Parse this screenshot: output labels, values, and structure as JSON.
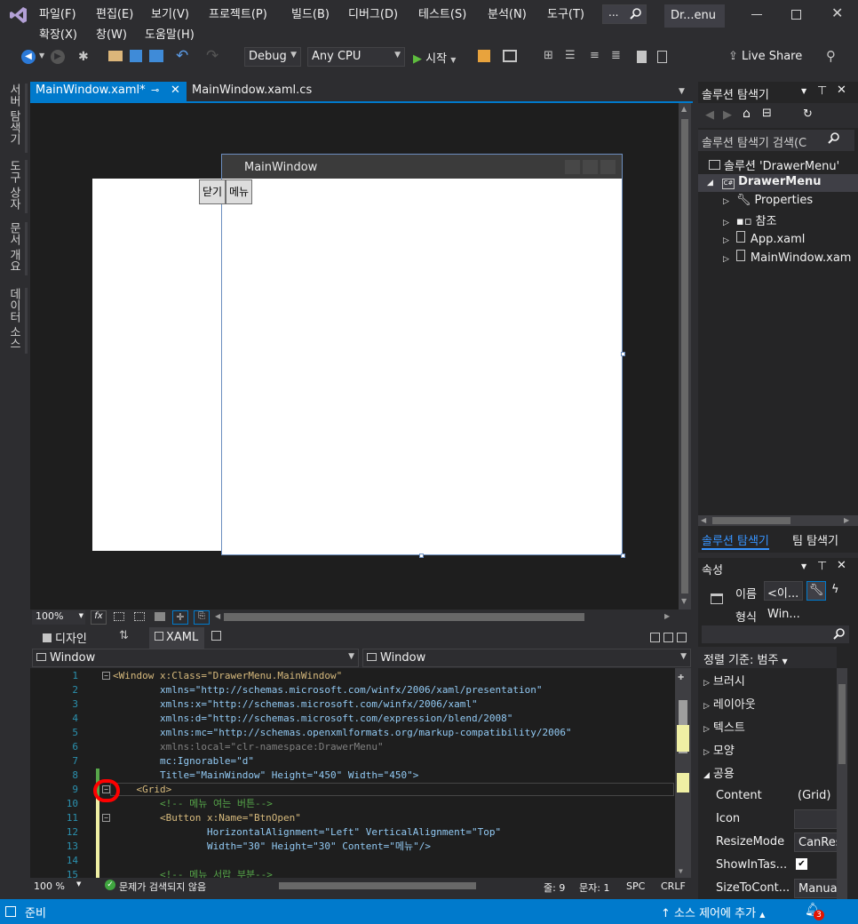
{
  "menus": [
    "파일(F)",
    "편집(E)",
    "보기(V)",
    "프로젝트(P)",
    "빌드(B)",
    "디버그(D)",
    "테스트(S)",
    "분석(N)",
    "도구(T)",
    "확장(X)",
    "창(W)",
    "도움말(H)"
  ],
  "search_label": "...",
  "window_title": "Dr...enu",
  "toolbar": {
    "config": "Debug",
    "platform": "Any CPU",
    "start_label": "시작",
    "live_share": "Live Share"
  },
  "left_tabs": [
    "서버 탐색기",
    "도구 상자",
    "문서 개요",
    "데이터 소스"
  ],
  "doc_tabs": {
    "active": "MainWindow.xaml*",
    "other": "MainWindow.xaml.cs"
  },
  "designer": {
    "window_title": "MainWindow",
    "close_btn": "닫기",
    "menu_btn": "메뉴",
    "zoom": "100%",
    "fx": "fx"
  },
  "split": {
    "design_tab": "디자인",
    "xaml_tab": "XAML",
    "swap": "⇅"
  },
  "nav": {
    "left": "Window",
    "right": "Window"
  },
  "code_lines": [
    {
      "n": "1",
      "t": "<Window x:Class=\"DrawerMenu.MainWindow\""
    },
    {
      "n": "2",
      "t": "        xmlns=\"http://schemas.microsoft.com/winfx/2006/xaml/presentation\""
    },
    {
      "n": "3",
      "t": "        xmlns:x=\"http://schemas.microsoft.com/winfx/2006/xaml\""
    },
    {
      "n": "4",
      "t": "        xmlns:d=\"http://schemas.microsoft.com/expression/blend/2008\""
    },
    {
      "n": "5",
      "t": "        xmlns:mc=\"http://schemas.openxmlformats.org/markup-compatibility/2006\""
    },
    {
      "n": "6",
      "t": "        xmlns:local=\"clr-namespace:DrawerMenu\""
    },
    {
      "n": "7",
      "t": "        mc:Ignorable=\"d\""
    },
    {
      "n": "8",
      "t": "        Title=\"MainWindow\" Height=\"450\" Width=\"450\">"
    },
    {
      "n": "9",
      "t": "    <Grid>"
    },
    {
      "n": "10",
      "t": "        <!-- 메뉴 여는 버튼-->"
    },
    {
      "n": "11",
      "t": "        <Button x:Name=\"BtnOpen\""
    },
    {
      "n": "12",
      "t": "                HorizontalAlignment=\"Left\" VerticalAlignment=\"Top\""
    },
    {
      "n": "13",
      "t": "                Width=\"30\" Height=\"30\" Content=\"메뉴\"/>"
    },
    {
      "n": "14",
      "t": ""
    },
    {
      "n": "15",
      "t": "        <!-- 메뉴 서랍 부분-->"
    }
  ],
  "code_status": {
    "zoom": "100 %",
    "issues": "문제가 검색되지 않음",
    "line": "줄: 9",
    "col": "문자: 1",
    "spc": "SPC",
    "crlf": "CRLF"
  },
  "status": {
    "ready": "준비",
    "source_control": "소스 제어에 추가",
    "notif_count": "3"
  },
  "solution": {
    "title": "솔루션 탐색기",
    "search": "솔루션 탐색기 검색(C",
    "root": "솔루션 'DrawerMenu'",
    "project": "DrawerMenu",
    "items": [
      "Properties",
      "참조",
      "App.xaml",
      "MainWindow.xam"
    ],
    "tab_active": "솔루션 탐색기",
    "tab_other": "팀 탐색기"
  },
  "properties": {
    "title": "속성",
    "name_label": "이름",
    "name_value": "<이...",
    "type_label": "형식",
    "type_value": "Win...",
    "arrange": "정렬 기준: 범주",
    "groups": [
      "브러시",
      "레이아웃",
      "텍스트",
      "모양",
      "공용"
    ],
    "rows": [
      {
        "label": "Content",
        "value": "(Grid)"
      },
      {
        "label": "Icon",
        "value": ""
      },
      {
        "label": "ResizeMode",
        "value": "CanRes"
      },
      {
        "label": "ShowInTas...",
        "value": "✔"
      },
      {
        "label": "SizeToCont...",
        "value": "Manua"
      }
    ]
  }
}
